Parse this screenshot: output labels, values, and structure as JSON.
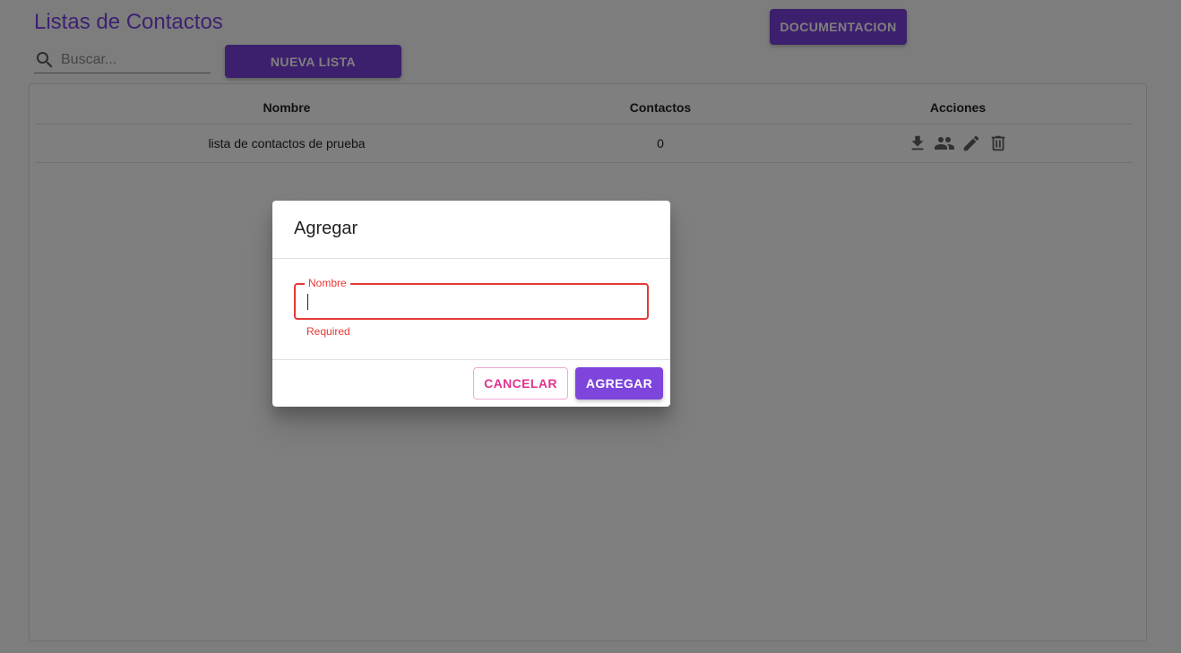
{
  "page": {
    "title": "Listas de Contactos",
    "documentation_label": "DOCUMENTACION",
    "new_list_label": "NUEVA LISTA"
  },
  "search": {
    "placeholder": "Buscar...",
    "value": "",
    "icon": "search-icon"
  },
  "table": {
    "headers": [
      "Nombre",
      "Contactos",
      "Acciones"
    ],
    "rows": [
      {
        "name": "lista de contactos de prueba",
        "contacts": "0",
        "actions": [
          "download-icon",
          "people-icon",
          "edit-icon",
          "delete-icon"
        ]
      }
    ]
  },
  "dialog": {
    "title": "Agregar",
    "field_label": "Nombre",
    "field_value": "",
    "helper_text": "Required",
    "cancel_label": "CANCELAR",
    "add_label": "AGREGAR"
  },
  "colors": {
    "accent": "#7b40db",
    "title": "#7c43e0",
    "error": "#e53935",
    "cancel_text": "#e0338e",
    "icon": "#616161"
  }
}
